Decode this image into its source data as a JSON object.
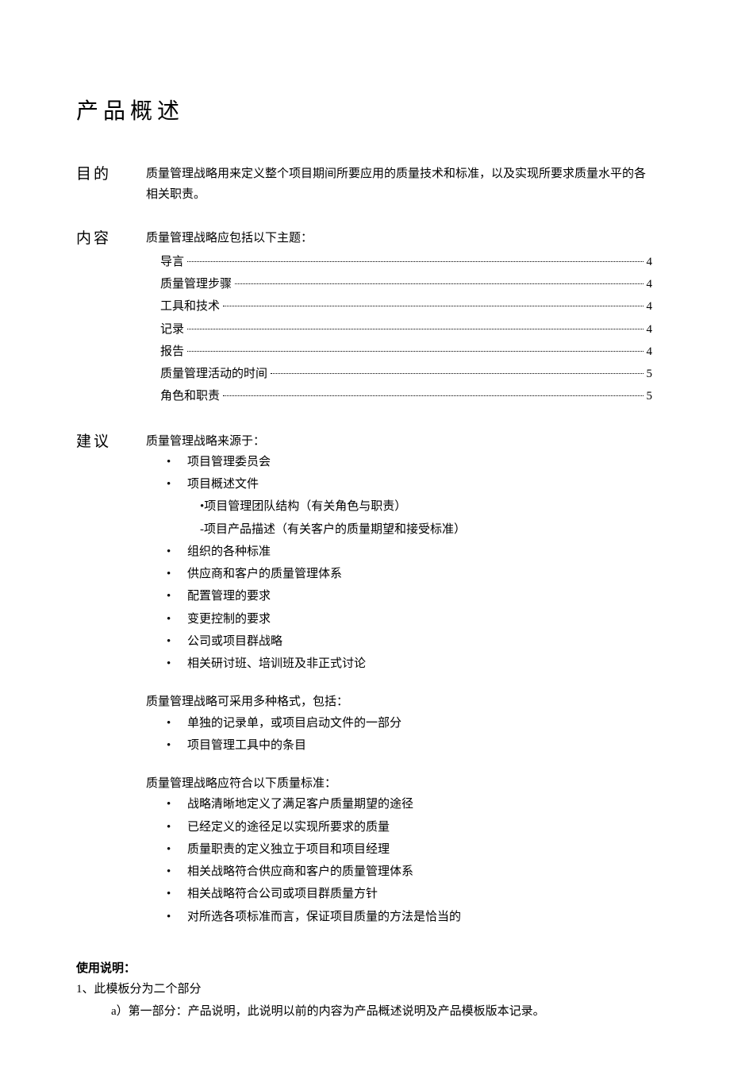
{
  "title": "产品概述",
  "purpose": {
    "label": "目的",
    "text": "质量管理战略用来定义整个项目期间所要应用的质量技术和标准，以及实现所要求质量水平的各相关职责。"
  },
  "contents": {
    "label": "内容",
    "intro": "质量管理战略应包括以下主题：",
    "toc": [
      {
        "label": "导言",
        "page": "4"
      },
      {
        "label": "质量管理步骤",
        "page": "4"
      },
      {
        "label": "工具和技术",
        "page": "4"
      },
      {
        "label": "记录",
        "page": "4"
      },
      {
        "label": "报告",
        "page": "4"
      },
      {
        "label": "质量管理活动的时间",
        "page": "5"
      },
      {
        "label": "角色和职责",
        "page": "5"
      }
    ]
  },
  "advice": {
    "label": "建议",
    "sources_intro": "质量管理战略来源于：",
    "sources": [
      "项目管理委员会",
      "项目概述文件"
    ],
    "sources_sub": [
      "•项目管理团队结构（有关角色与职责）",
      "-项目产品描述（有关客户的质量期望和接受标准）"
    ],
    "sources_more": [
      "组织的各种标准",
      "供应商和客户的质量管理体系",
      "配置管理的要求",
      "变更控制的要求",
      "公司或项目群战略",
      "相关研讨班、培训班及非正式讨论"
    ],
    "formats_intro": "质量管理战略可采用多种格式，包括：",
    "formats": [
      "单独的记录单，或项目启动文件的一部分",
      "项目管理工具中的条目"
    ],
    "standards_intro": "质量管理战略应符合以下质量标准：",
    "standards": [
      "战略清晰地定义了满足客户质量期望的途径",
      "已经定义的途径足以实现所要求的质量",
      "质量职责的定义独立于项目和项目经理",
      "相关战略符合供应商和客户的质量管理体系",
      "相关战略符合公司或项目群质量方针",
      "对所选各项标准而言，保证项目质量的方法是恰当的"
    ]
  },
  "usage": {
    "heading": "使用说明：",
    "line1": "1、此模板分为二个部分",
    "sub_a": "a）第一部分：产品说明，此说明以前的内容为产品概述说明及产品模板版本记录。"
  }
}
